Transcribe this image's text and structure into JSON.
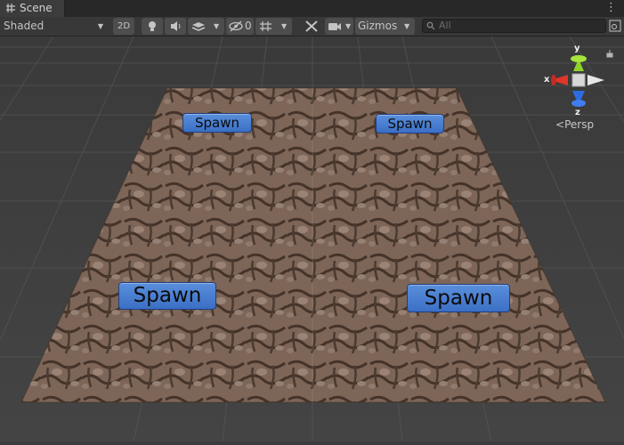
{
  "tab": {
    "title": "Scene",
    "icon": "grid-hash-icon"
  },
  "menu_icon": "kebab-menu-icon",
  "toolbar": {
    "shading_mode": "Shaded",
    "mode_2d": "2D",
    "hidden_count": "0",
    "gizmos_label": "Gizmos",
    "search_placeholder": "All"
  },
  "spawn_points": [
    {
      "label": "Spawn"
    },
    {
      "label": "Spawn"
    },
    {
      "label": "Spawn"
    },
    {
      "label": "Spawn"
    }
  ],
  "orientation_gizmo": {
    "axis_x": "x",
    "axis_y": "y",
    "axis_z": "z",
    "projection": "Persp",
    "colors": {
      "x": "#e0352a",
      "y": "#8fd12b",
      "z": "#2d6be0",
      "neutral": "#d8d8d8"
    }
  }
}
